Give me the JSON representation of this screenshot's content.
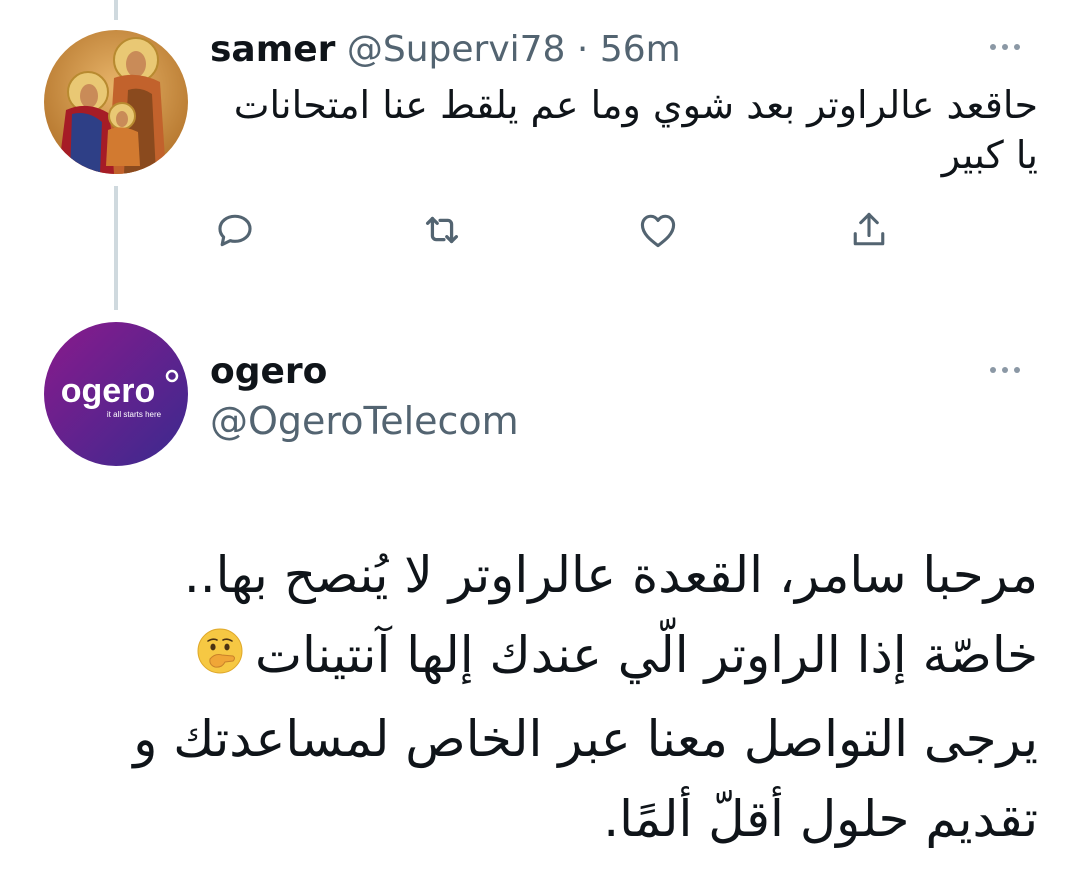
{
  "tweet1": {
    "name": "samer",
    "handle": "@Supervi78",
    "separator": "·",
    "time": "56m",
    "text_lines": [
      "حاقعد عالراوتر بعد شوي وما عم يلقط عنا امتحانات",
      "يا كبير"
    ],
    "avatar_icon": "holy-family-icon-avatar",
    "actions": [
      {
        "name": "reply",
        "icon": "reply-icon"
      },
      {
        "name": "retweet",
        "icon": "retweet-icon"
      },
      {
        "name": "like",
        "icon": "heart-icon"
      },
      {
        "name": "share",
        "icon": "share-icon"
      }
    ]
  },
  "tweet2": {
    "name": "ogero",
    "handle": "@OgeroTelecom",
    "avatar": {
      "logo_text": "ogero",
      "tagline": "it all starts here",
      "gradient_colors": [
        "#8a1a8c",
        "#3a2a8f"
      ]
    },
    "text_lines": [
      "مرحبا سامر، القعدة عالراوتر لا يُنصح بها..",
      "خاصّة إذا الراوتر الّي عندك إلها آنتينات",
      "يرجى التواصل معنا عبر الخاص لمساعدتك و",
      "تقديم حلول أقلّ ألمًا."
    ],
    "emoji": "face-with-hand-over-mouth-icon"
  },
  "colors": {
    "text": "#0f1419",
    "secondary": "#536471",
    "thread_line": "#cfd9de",
    "icon": "#536471"
  }
}
